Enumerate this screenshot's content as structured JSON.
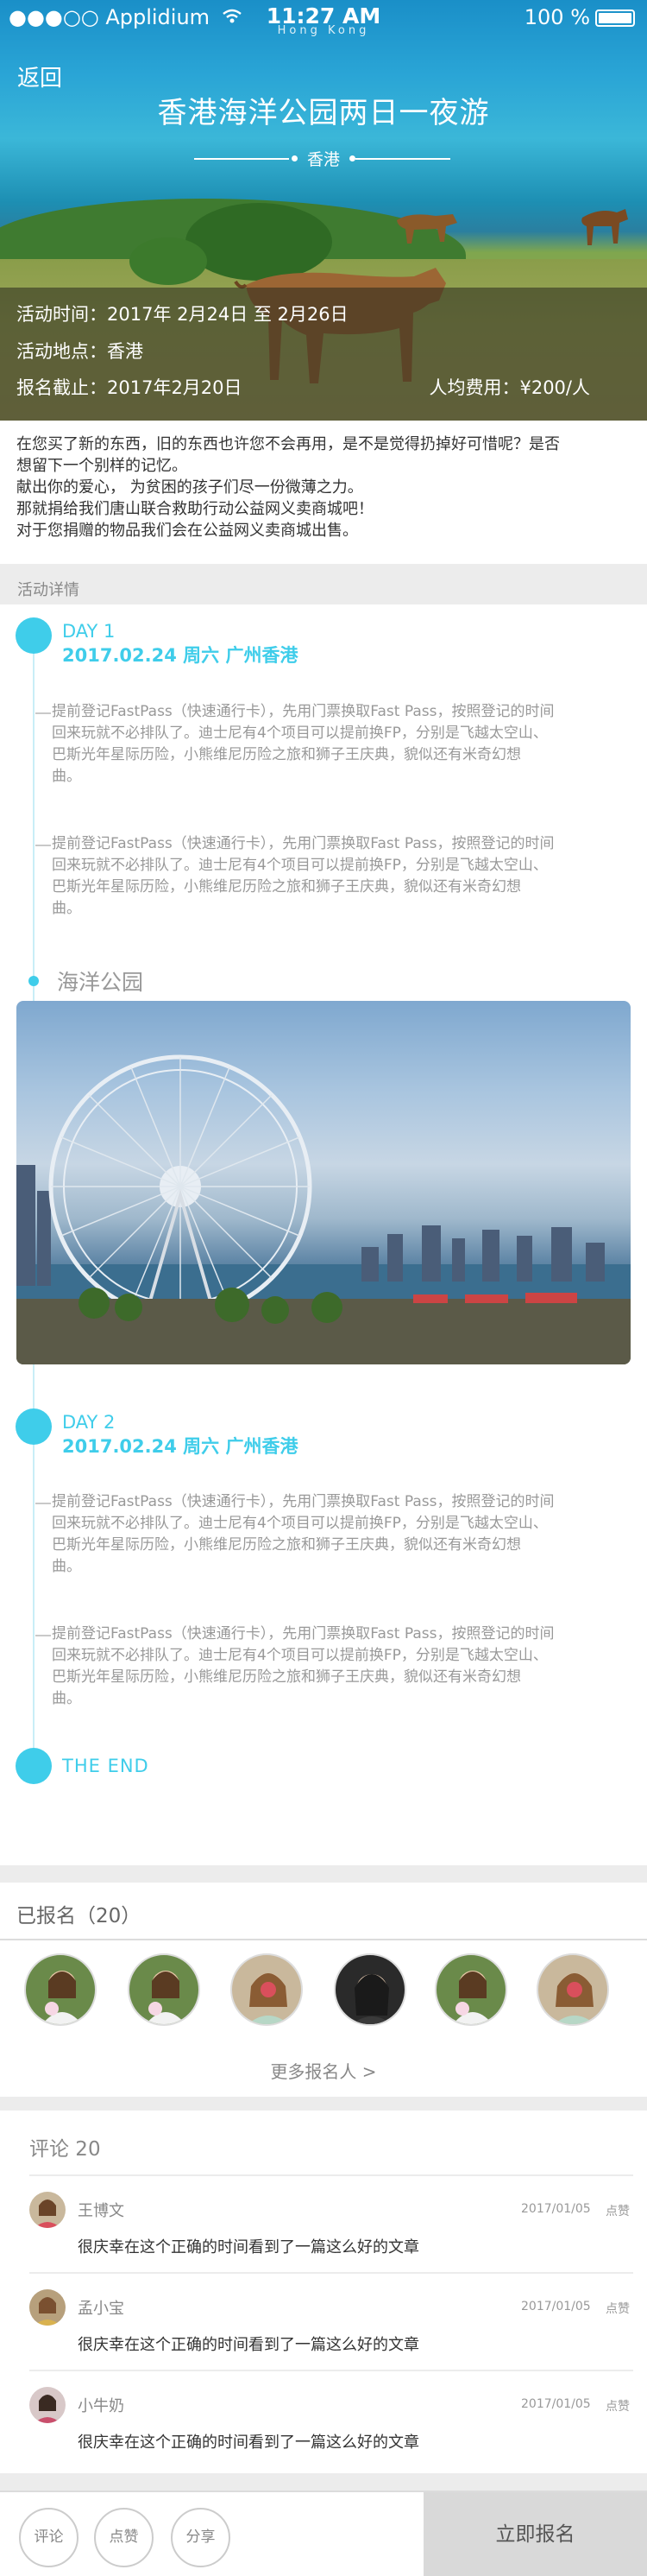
{
  "status_bar": {
    "carrier": "●●●○○ Applidium",
    "time": "11:27 AM",
    "time_sub": "Hong Kong",
    "battery": "100 %"
  },
  "header": {
    "back_label": "返回",
    "title": "香港海洋公园两日一夜游",
    "location": "香港"
  },
  "info": {
    "time": "活动时间：2017年  2月24日  至  2月26日",
    "place": "活动地点：香港",
    "deadline": "报名截止：2017年2月20日",
    "fee": "人均费用：¥200/人"
  },
  "intro": [
    "在您买了新的东西，旧的东西也许您不会再用，是不是觉得扔掉好可惜呢？是否",
    "想留下一个别样的记忆。",
    "献出你的爱心， 为贫困的孩子们尽一份微薄之力。",
    "那就捐给我们唐山联合救助行动公益网义卖商城吧！",
    "对于您捐赠的物品我们会在公益网义卖商城出售。"
  ],
  "details": {
    "section_title": "活动详情",
    "day1": {
      "label": "DAY 1",
      "date": "2017.02.24  周六  广州香港"
    },
    "paragraph_lines": [
      "提前登记FastPass（快速通行卡），先用门票换取Fast Pass，按照登记的时间",
      "回来玩就不必排队了。迪士尼有4个项目可以提前换FP，分别是飞越太空山、",
      "巴斯光年星际历险，小熊维尼历险之旅和狮子王庆典，貌似还有米奇幻想",
      "曲。"
    ],
    "place_name": "海洋公园",
    "day2": {
      "label": "DAY 2",
      "date": "2017.02.24  周六  广州香港"
    },
    "end_label": "THE  END"
  },
  "signups": {
    "title": "已报名（20）",
    "more_label": "更多报名人 >",
    "count": 6
  },
  "comments": {
    "title": "评论   20",
    "items": [
      {
        "name": "王博文",
        "date": "2017/01/05",
        "like": "点赞",
        "text": "很庆幸在这个正确的时间看到了一篇这么好的文章"
      },
      {
        "name": "孟小宝",
        "date": "2017/01/05",
        "like": "点赞",
        "text": "很庆幸在这个正确的时间看到了一篇这么好的文章"
      },
      {
        "name": "小牛奶",
        "date": "2017/01/05",
        "like": "点赞",
        "text": "很庆幸在这个正确的时间看到了一篇这么好的文章"
      }
    ]
  },
  "bottom_bar": {
    "comment": "评论",
    "like": "点赞",
    "share": "分享",
    "signup": "立即报名"
  },
  "colors": {
    "accent": "#3fcdea",
    "section_bg": "#ececec",
    "signup_bg": "#d9d9d9"
  }
}
